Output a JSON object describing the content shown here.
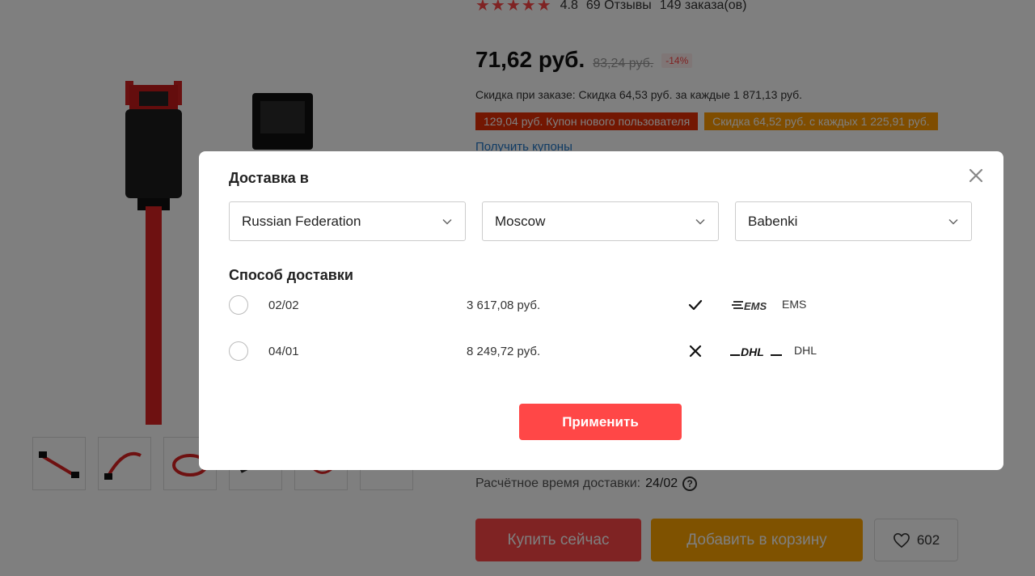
{
  "background": {
    "rating": {
      "score": "4.8",
      "reviews": "69 Отзывы",
      "orders": "149 заказа(ов)"
    },
    "price": {
      "current": "71,62 руб.",
      "old": "83,24 руб.",
      "discount": "-14%"
    },
    "order_discount": "Скидка при заказе: Скидка 64,53 руб. за каждые 1 871,13 руб.",
    "coupons": [
      "129,04 руб. Купон нового пользователя",
      "Скидка 64,52 руб. с каждых 1 225,91 руб."
    ],
    "get_coupons": "Получить купоны",
    "delivery_time": {
      "label": "Расчётное время доставки:",
      "value": "24/02"
    },
    "buttons": {
      "buy_now": "Купить сейчас",
      "add_to_cart": "Добавить в корзину",
      "wishlist_count": "602"
    }
  },
  "modal": {
    "title": "Доставка в",
    "selects": [
      {
        "value": "Russian Federation"
      },
      {
        "value": "Moscow"
      },
      {
        "value": "Babenki"
      }
    ],
    "shipping_title": "Способ доставки",
    "shipping_options": [
      {
        "date": "02/02",
        "price": "3 617,08 руб.",
        "tracking": "check",
        "logo_text": "EMS",
        "carrier": "EMS"
      },
      {
        "date": "04/01",
        "price": "8 249,72 руб.",
        "tracking": "cross",
        "logo_text": "DHL",
        "carrier": "DHL"
      }
    ],
    "apply_label": "Применить"
  },
  "colors": {
    "accent_red": "#ff4747",
    "accent_orange": "#ffa500",
    "coupon_red": "#e62e04",
    "link_blue": "#2177c9",
    "dhl_red": "#d40511"
  },
  "icons": {
    "close": "close-icon",
    "chevron": "chevron-down-icon",
    "check": "check-icon",
    "cross": "cross-icon",
    "heart": "heart-icon",
    "question": "question-icon"
  }
}
